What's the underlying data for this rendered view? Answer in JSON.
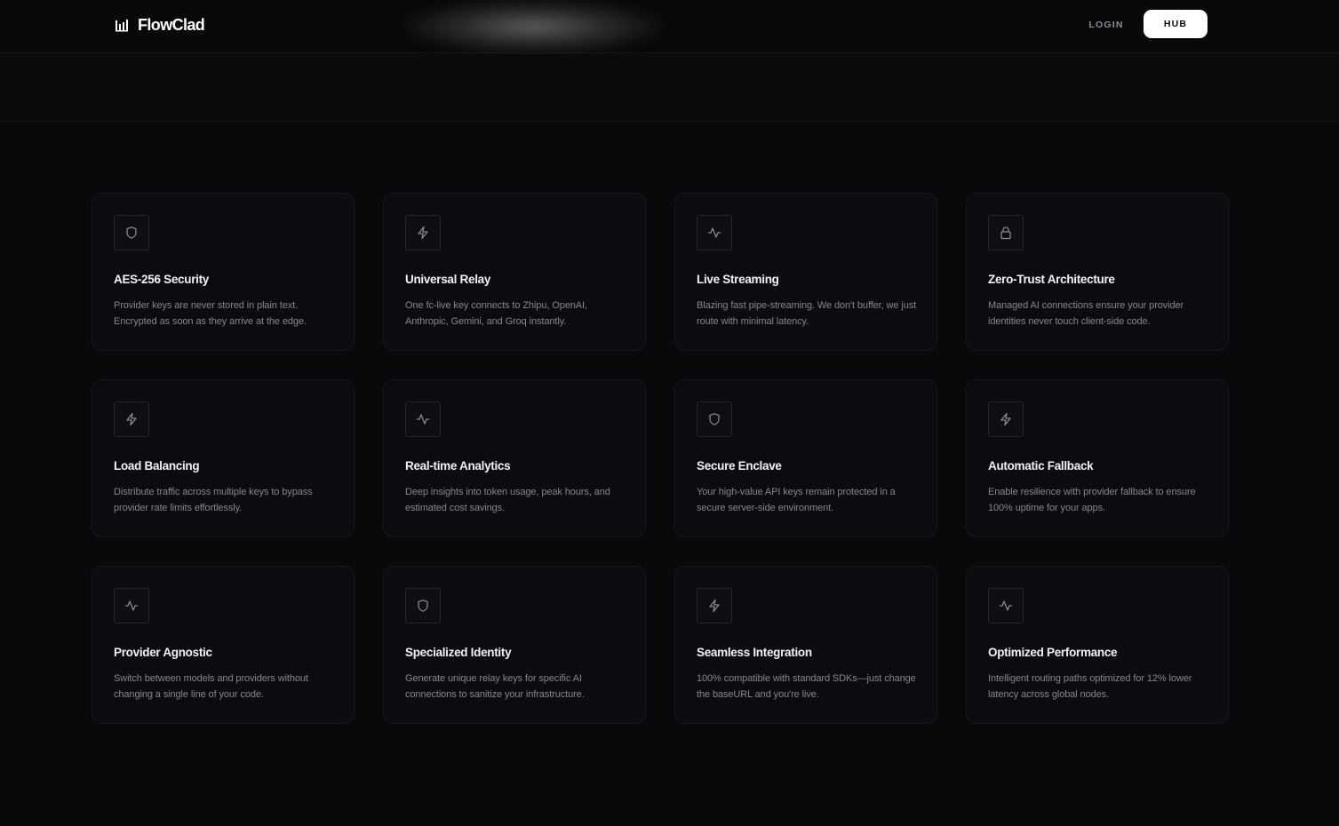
{
  "nav": {
    "brand_name": "FlowClad",
    "login_label": "LOGIN",
    "hub_label": "HUB"
  },
  "colors": {
    "background": "#08090b",
    "card_background": "#0b0c0f",
    "accent_button": "#ffffff"
  },
  "features": [
    {
      "icon": "shield-icon",
      "title": "AES-256 Security",
      "description": "Provider keys are never stored in plain text. Encrypted as soon as they arrive at the edge."
    },
    {
      "icon": "zap-icon",
      "title": "Universal Relay",
      "description": "One fc-live key connects to Zhipu, OpenAI, Anthropic, Gemini, and Groq instantly."
    },
    {
      "icon": "activity-icon",
      "title": "Live Streaming",
      "description": "Blazing fast pipe-streaming. We don't buffer, we just route with minimal latency."
    },
    {
      "icon": "lock-icon",
      "title": "Zero-Trust Architecture",
      "description": "Managed AI connections ensure your provider identities never touch client-side code."
    },
    {
      "icon": "zap-icon",
      "title": "Load Balancing",
      "description": "Distribute traffic across multiple keys to bypass provider rate limits effortlessly."
    },
    {
      "icon": "activity-icon",
      "title": "Real-time Analytics",
      "description": "Deep insights into token usage, peak hours, and estimated cost savings."
    },
    {
      "icon": "shield-icon",
      "title": "Secure Enclave",
      "description": "Your high-value API keys remain protected in a secure server-side environment."
    },
    {
      "icon": "zap-icon",
      "title": "Automatic Fallback",
      "description": "Enable resilience with provider fallback to ensure 100% uptime for your apps."
    },
    {
      "icon": "activity-icon",
      "title": "Provider Agnostic",
      "description": "Switch between models and providers without changing a single line of your code."
    },
    {
      "icon": "shield-icon",
      "title": "Specialized Identity",
      "description": "Generate unique relay keys for specific AI connections to sanitize your infrastructure."
    },
    {
      "icon": "zap-icon",
      "title": "Seamless Integration",
      "description": "100% compatible with standard SDKs—just change the baseURL and you're live."
    },
    {
      "icon": "activity-icon",
      "title": "Optimized Performance",
      "description": "Intelligent routing paths optimized for 12% lower latency across global nodes."
    }
  ]
}
